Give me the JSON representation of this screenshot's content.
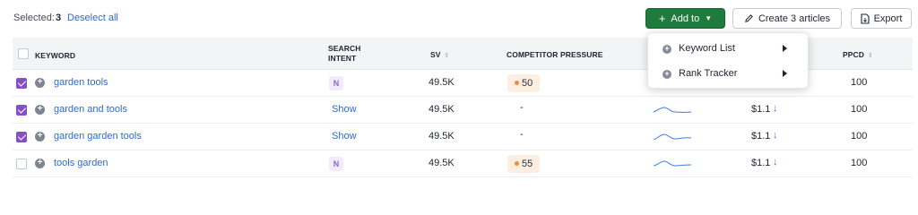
{
  "toolbar": {
    "selected_label": "Selected:",
    "selected_count": "3",
    "deselect_label": "Deselect all",
    "add_to_label": "Add to",
    "create_label": "Create 3 articles",
    "export_label": "Export",
    "add_to_color": "#1f7a3e"
  },
  "dropdown": {
    "items": [
      {
        "label": "Keyword List",
        "icon": "plus-circle-icon"
      },
      {
        "label": "Rank Tracker",
        "icon": "plus-circle-icon"
      }
    ]
  },
  "table": {
    "headers": {
      "keyword": "KEYWORD",
      "intent_line1": "SEARCH",
      "intent_line2": "INTENT",
      "sv": "SV",
      "competitor": "COMPETITOR PRESSURE",
      "ppcd": "PPCD"
    },
    "rows": [
      {
        "checked": true,
        "keyword": "garden tools",
        "intent": "N",
        "sv": "49.5K",
        "competitor": "50",
        "cpc": "",
        "ppcd": "100"
      },
      {
        "checked": true,
        "keyword": "garden and tools",
        "intent": "Show",
        "sv": "49.5K",
        "competitor": "-",
        "cpc": "$1.1",
        "ppcd": "100"
      },
      {
        "checked": true,
        "keyword": "garden garden tools",
        "intent": "Show",
        "sv": "49.5K",
        "competitor": "-",
        "cpc": "$1.1",
        "ppcd": "100"
      },
      {
        "checked": false,
        "keyword": "tools garden",
        "intent": "N",
        "sv": "49.5K",
        "competitor": "55",
        "cpc": "$1.1",
        "ppcd": "100"
      }
    ]
  },
  "colors": {
    "checkbox_checked": "#8450c3",
    "link": "#2d6ad6",
    "competitor_dot": "#f08a3c",
    "trend_line": "#3d7de0"
  }
}
